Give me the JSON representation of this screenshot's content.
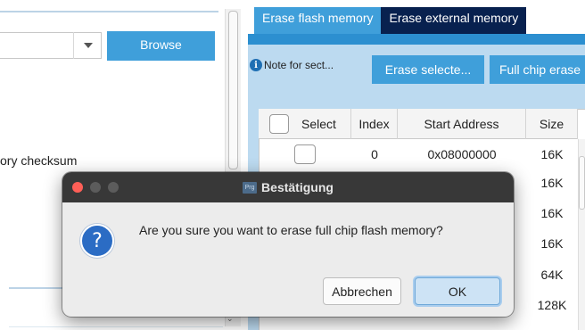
{
  "left_panel": {
    "browse_label": "Browse",
    "checksum_label": "ory checksum"
  },
  "tabs": [
    {
      "label": "Erase flash memory",
      "active": true
    },
    {
      "label": "Erase external memory",
      "active": false
    }
  ],
  "actions": {
    "note_label": "Note for sect...",
    "erase_selected_label": "Erase selecte...",
    "full_chip_erase_label": "Full chip erase"
  },
  "sector_table": {
    "columns": [
      "Select",
      "Index",
      "Start Address",
      "Size"
    ],
    "rows": [
      {
        "index": "0",
        "address": "0x08000000",
        "size": "16K"
      },
      {
        "index": "",
        "address": "",
        "size": "16K"
      },
      {
        "index": "",
        "address": "",
        "size": "16K"
      },
      {
        "index": "",
        "address": "",
        "size": "16K"
      },
      {
        "index": "",
        "address": "",
        "size": "64K"
      },
      {
        "index": "",
        "address": "",
        "size": "128K"
      }
    ]
  },
  "dialog": {
    "title": "Bestätigung",
    "app_icon_text": "Prg",
    "message": "Are you sure you want to erase full chip flash memory?",
    "cancel_label": "Abbrechen",
    "ok_label": "OK"
  },
  "colors": {
    "accent_blue": "#3f9fda",
    "tab_inactive": "#08214f",
    "tab_area": "#bcdaf0",
    "dialog_titlebar": "#383838",
    "close_red": "#ff5f57"
  }
}
